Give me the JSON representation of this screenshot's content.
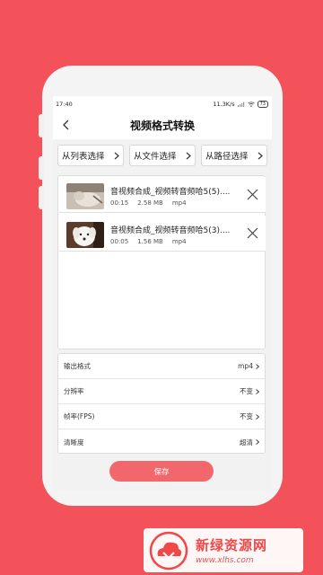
{
  "status_bar": {
    "time": "17:40",
    "net_speed": "11.3K/s",
    "battery": "73"
  },
  "header": {
    "title": "视频格式转换"
  },
  "source_buttons": [
    {
      "label": "从列表选择"
    },
    {
      "label": "从文件选择"
    },
    {
      "label": "从路径选择"
    }
  ],
  "files": [
    {
      "name": "音视频合成_视频转音频哈5(5)....",
      "duration": "00:15",
      "size": "2.58 MB",
      "format": "mp4",
      "thumb": "cat-photo"
    },
    {
      "name": "音视频合成_视频转音频哈5(3)....",
      "duration": "00:05",
      "size": "1.56 MB",
      "format": "mp4",
      "thumb": "dog-photo"
    }
  ],
  "settings": [
    {
      "label": "输出格式",
      "value": "mp4"
    },
    {
      "label": "分辨率",
      "value": "不变"
    },
    {
      "label": "帧率(FPS)",
      "value": "不变"
    },
    {
      "label": "清晰度",
      "value": "超清"
    }
  ],
  "save_label": "保存",
  "watermark": {
    "title": "新绿资源网",
    "url": "www.xlhs.com"
  },
  "colors": {
    "background": "#f3525b",
    "save_button": "#f1676b",
    "watermark": "#f04848"
  }
}
